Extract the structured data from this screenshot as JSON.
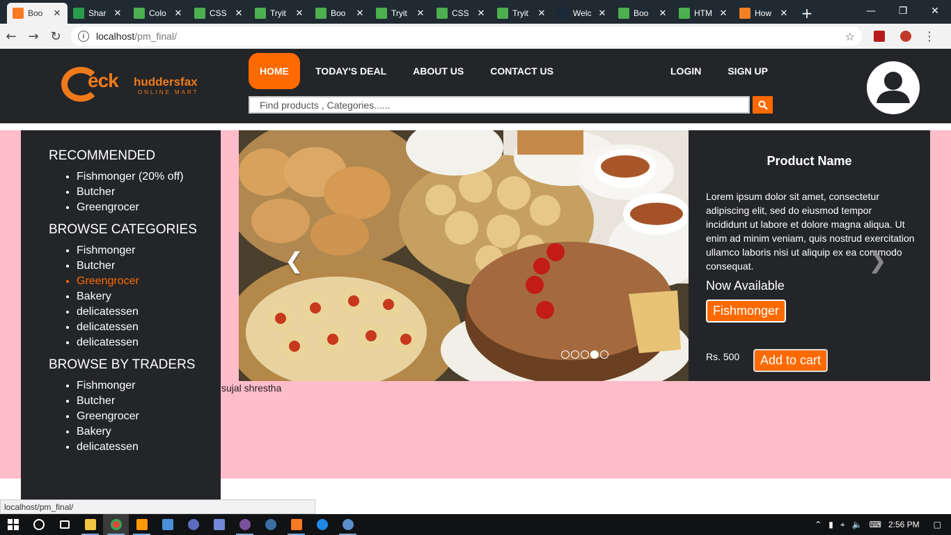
{
  "browser": {
    "tabs": [
      {
        "title": "Boo",
        "favicon": "xampp-icon",
        "color": "#fb7a24",
        "active": true
      },
      {
        "title": "Shar",
        "favicon": "google-drive-icon",
        "color": "#2a9d4b",
        "active": false
      },
      {
        "title": "Colo",
        "favicon": "w3schools-icon",
        "color": "#4caf50",
        "active": false
      },
      {
        "title": "CSS",
        "favicon": "w3schools-icon",
        "color": "#4caf50",
        "active": false
      },
      {
        "title": "Tryit",
        "favicon": "w3schools-icon",
        "color": "#4caf50",
        "active": false
      },
      {
        "title": "Boo",
        "favicon": "w3schools-icon",
        "color": "#4caf50",
        "active": false
      },
      {
        "title": "Tryit",
        "favicon": "w3schools-icon",
        "color": "#4caf50",
        "active": false
      },
      {
        "title": "CSS",
        "favicon": "w3schools-icon",
        "color": "#4caf50",
        "active": false
      },
      {
        "title": "Tryit",
        "favicon": "w3schools-icon",
        "color": "#4caf50",
        "active": false
      },
      {
        "title": "Welc",
        "favicon": "steam-icon",
        "color": "#1b2838",
        "active": false
      },
      {
        "title": "Boo",
        "favicon": "w3schools-icon",
        "color": "#4caf50",
        "active": false
      },
      {
        "title": "HTM",
        "favicon": "w3schools-icon",
        "color": "#4caf50",
        "active": false
      },
      {
        "title": "How",
        "favicon": "stackoverflow-icon",
        "color": "#f48024",
        "active": false
      }
    ],
    "url_host": "localhost",
    "url_path": "/pm_final/"
  },
  "site": {
    "logo": {
      "eck": "eck",
      "name": "huddersfax",
      "tagline": "ONLINE MART"
    },
    "nav": {
      "home": "HOME",
      "deal": "TODAY'S DEAL",
      "about": "ABOUT US",
      "contact": "CONTACT US"
    },
    "auth": {
      "login": "LOGIN",
      "signup": "SIGN UP"
    },
    "search": {
      "placeholder": "Find products , Categories......"
    },
    "accent": "#ff6a00"
  },
  "sidebar": {
    "recommended_title": "RECOMMENDED",
    "recommended": [
      "Fishmonger (20% off)",
      "Butcher",
      "Greengrocer"
    ],
    "categories_title": "BROWSE CATEGORIES",
    "categories": [
      "Fishmonger",
      "Butcher",
      "Greengrocer",
      "Bakery",
      "delicatessen",
      "delicatessen",
      "delicatessen"
    ],
    "categories_active_index": 2,
    "traders_title": "BROWSE BY TRADERS",
    "traders": [
      "Fishmonger",
      "Butcher",
      "Greengrocer",
      "Bakery",
      "delicatessen"
    ]
  },
  "carousel": {
    "slide_count": 5,
    "active_index": 3
  },
  "product": {
    "name": "Product Name",
    "description": "Lorem ipsum dolor sit amet, consectetur adipiscing elit, sed do eiusmod tempor incididunt ut labore et dolore magna aliqua. Ut enim ad minim veniam, quis nostrud exercitation ullamco laboris nisi ut aliquip ex ea commodo consequat.",
    "availability": "Now Available",
    "trader": "Fishmonger",
    "price": "Rs. 500",
    "add_to_cart": "Add to cart"
  },
  "footnote": "sujal shrestha",
  "statusbar": "localhost/pm_final/",
  "taskbar": {
    "time": "2:56 PM"
  }
}
